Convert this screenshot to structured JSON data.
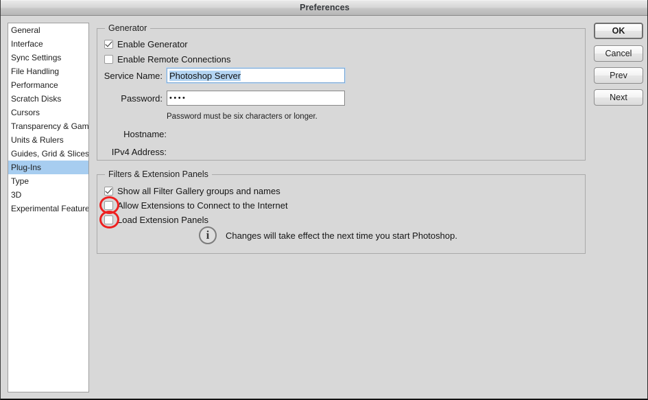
{
  "window": {
    "title": "Preferences"
  },
  "sidebar": {
    "items": [
      {
        "label": "General",
        "selected": false
      },
      {
        "label": "Interface",
        "selected": false
      },
      {
        "label": "Sync Settings",
        "selected": false
      },
      {
        "label": "File Handling",
        "selected": false
      },
      {
        "label": "Performance",
        "selected": false
      },
      {
        "label": "Scratch Disks",
        "selected": false
      },
      {
        "label": "Cursors",
        "selected": false
      },
      {
        "label": "Transparency & Gamut",
        "selected": false
      },
      {
        "label": "Units & Rulers",
        "selected": false
      },
      {
        "label": "Guides, Grid & Slices",
        "selected": false
      },
      {
        "label": "Plug-Ins",
        "selected": true
      },
      {
        "label": "Type",
        "selected": false
      },
      {
        "label": "3D",
        "selected": false
      },
      {
        "label": "Experimental Features",
        "selected": false
      }
    ]
  },
  "generator": {
    "legend": "Generator",
    "enable_generator": {
      "label": "Enable Generator",
      "checked": true
    },
    "enable_remote": {
      "label": "Enable Remote Connections",
      "checked": false
    },
    "service_name": {
      "label": "Service Name:",
      "value": "Photoshop Server",
      "selected": true,
      "focused": true
    },
    "password": {
      "label": "Password:",
      "value": "••••",
      "hint": "Password must be six characters or longer."
    },
    "hostname": {
      "label": "Hostname:",
      "value": ""
    },
    "ipv4": {
      "label": "IPv4 Address:",
      "value": ""
    }
  },
  "filters": {
    "legend": "Filters & Extension Panels",
    "show_filter_gallery": {
      "label": "Show all Filter Gallery groups and names",
      "checked": true
    },
    "allow_extensions_internet": {
      "label": "Allow Extensions to Connect to the Internet",
      "checked": false,
      "annotated": true
    },
    "load_extension_panels": {
      "label": "Load Extension Panels",
      "checked": false,
      "annotated": true
    },
    "note": {
      "icon": "info-icon",
      "glyph": "i",
      "text": "Changes will take effect the next time you start Photoshop."
    }
  },
  "buttons": {
    "ok": "OK",
    "cancel": "Cancel",
    "prev": "Prev",
    "next": "Next"
  },
  "colors": {
    "window_bg": "#d8d8d8",
    "selection_blue": "#a7cdf0",
    "text_selection_blue": "#b3d4f2",
    "annotation_red": "#ee2020",
    "group_border": "#a9a9a9"
  }
}
